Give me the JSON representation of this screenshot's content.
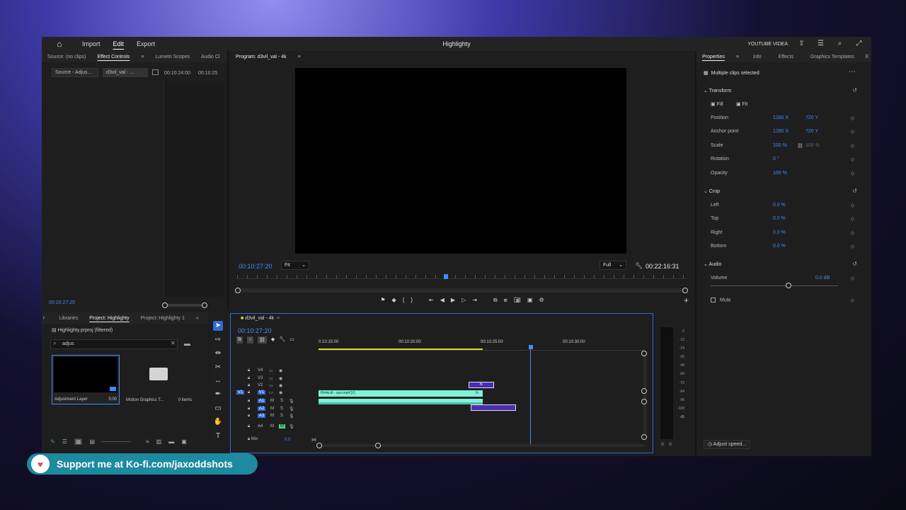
{
  "app": {
    "title": "Highlighty",
    "menu": [
      "Import",
      "Edit",
      "Export"
    ],
    "active_menu": "Edit",
    "brand_tag": "YOUTUBE VIDEA"
  },
  "source_panel": {
    "tabs": [
      "Source: (no clips)",
      "Effect Controls",
      "Lumetri Scopes",
      "Audio Cl"
    ],
    "mini_tabs": [
      "Source - Adjus...",
      "d3vil_val - ..."
    ],
    "times": [
      "00:10:24:00",
      "00:10:25"
    ],
    "timecode": "00:10:27:20"
  },
  "program": {
    "tab": "Program: d3vil_val - 4k",
    "timecode": "00:10:27:20",
    "fit": "Fit",
    "quality": "Full",
    "duration": "00:22:16:31"
  },
  "properties": {
    "tabs": [
      "Properties",
      "Info",
      "Effects",
      "Graphics Templates",
      "E"
    ],
    "selection": "Multiple clips selected",
    "transform_label": "Transform",
    "fill_label": "Fill",
    "fit_label": "Fit",
    "rows": [
      {
        "label": "Position",
        "v1": "1280 X",
        "v2": "720 Y"
      },
      {
        "label": "Anchor point",
        "v1": "1280 X",
        "v2": "720 Y"
      },
      {
        "label": "Scale",
        "v1": "100 %",
        "v2": "100 %"
      },
      {
        "label": "Rotation",
        "v1": "0 °",
        "v2": ""
      },
      {
        "label": "Opacity",
        "v1": "100 %",
        "v2": ""
      }
    ],
    "crop_label": "Crop",
    "crop_rows": [
      {
        "label": "Left",
        "v1": "0.0 %"
      },
      {
        "label": "Top",
        "v1": "0.0 %"
      },
      {
        "label": "Right",
        "v1": "0.0 %"
      },
      {
        "label": "Bottom",
        "v1": "0.0 %"
      }
    ],
    "audio_label": "Audio",
    "volume_label": "Volume",
    "volume_value": "0.0 dB",
    "mute_label": "Mute",
    "adjust_speed": "Adjust speed..."
  },
  "project": {
    "tabs": [
      "r",
      "Libraries",
      "Project: Highlighty",
      "Project: Highlighty 1"
    ],
    "file": "Highlighty.prproj (filtered)",
    "search_value": "adjus",
    "items": [
      {
        "name": "Adjustment Layer",
        "duration": "5:00"
      },
      {
        "name": "Motion Graphics T...",
        "count": "0 items"
      }
    ]
  },
  "timeline": {
    "tab": "d3vil_val - 4k",
    "timecode": "00:10:27:20",
    "ruler": [
      "0:10:15:00",
      "00:10:20:00",
      "00:10:25:00",
      "00:10:30:00"
    ],
    "tracks": [
      "V4",
      "V3",
      "V2",
      "V1",
      "A1",
      "A2",
      "A3",
      "A4"
    ],
    "v1_clip": "Rh4w.itl - ace.mp4 [V]",
    "fx": "fx",
    "mix_label": "Mix",
    "mix_value": "0.0"
  },
  "meters": {
    "scale": [
      "0",
      "-12",
      "-24",
      "-36",
      "-48",
      "-60",
      "-72",
      "-84",
      "-96",
      "-108",
      "dB"
    ],
    "solo": [
      "S",
      "S"
    ]
  },
  "overlay": {
    "kofi_text": "Support me at Ko-fi.com/jaxoddshots"
  },
  "colors": {
    "accent": "#3f8cff",
    "clip_video": "#7ff2d8",
    "clip_adjust": "#4d2bb8"
  }
}
